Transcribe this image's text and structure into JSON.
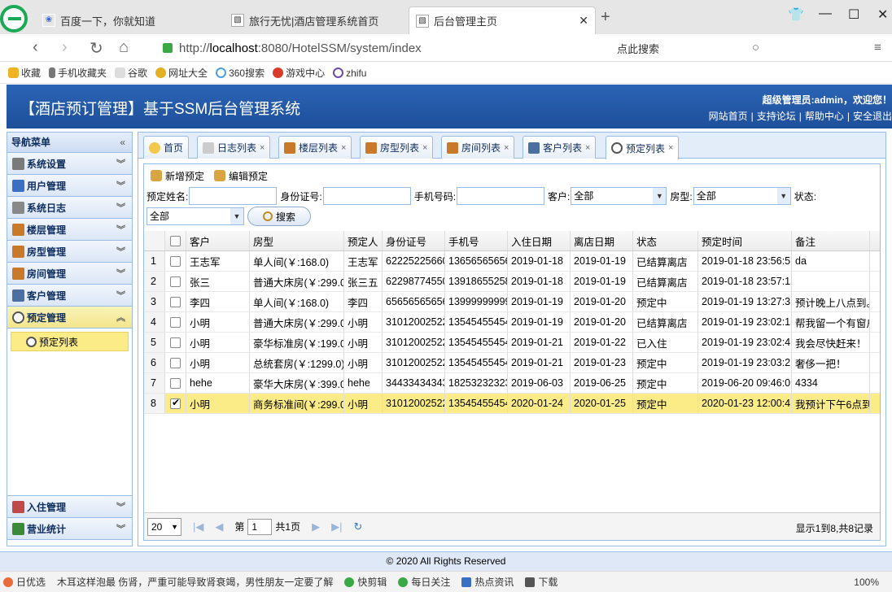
{
  "browser": {
    "tabs": [
      {
        "title": "百度一下，你就知道",
        "active": false
      },
      {
        "title": "旅行无忧|酒店管理系统首页",
        "active": false
      },
      {
        "title": "后台管理主页",
        "active": true
      }
    ],
    "url_prefix": "http://",
    "url_host": "localhost",
    "url_rest": ":8080/HotelSSM/system/index",
    "search_hint": "点此搜索",
    "bookmarks": [
      "收藏",
      "手机收藏夹",
      "谷歌",
      "网址大全",
      "360搜索",
      "游戏中心",
      "zhifu"
    ],
    "zoom": "100%"
  },
  "app": {
    "title": "【酒店预订管理】基于SSM后台管理系统",
    "welcome": "超级管理员:admin，欢迎您！",
    "links": [
      "网站首页",
      "支持论坛",
      "帮助中心",
      "安全退出"
    ]
  },
  "sidebar": {
    "header": "导航菜单",
    "items": [
      {
        "label": "系统设置",
        "color": "#7a7a7a"
      },
      {
        "label": "用户管理",
        "color": "#3a6fc1"
      },
      {
        "label": "系统日志",
        "color": "#888888"
      },
      {
        "label": "楼层管理",
        "color": "#c8792a"
      },
      {
        "label": "房型管理",
        "color": "#c8792a"
      },
      {
        "label": "房间管理",
        "color": "#c8792a"
      },
      {
        "label": "客户管理",
        "color": "#4a6fa0"
      },
      {
        "label": "预定管理",
        "color": "#6b6b6b"
      }
    ],
    "sub_item": "预定列表",
    "bottom_items": [
      {
        "label": "入住管理",
        "color": "#c04a4a"
      },
      {
        "label": "营业统计",
        "color": "#3a8a3a"
      }
    ]
  },
  "content_tabs": [
    {
      "label": "首页",
      "closable": false
    },
    {
      "label": "日志列表",
      "closable": true
    },
    {
      "label": "楼层列表",
      "closable": true
    },
    {
      "label": "房型列表",
      "closable": true
    },
    {
      "label": "房间列表",
      "closable": true
    },
    {
      "label": "客户列表",
      "closable": true
    },
    {
      "label": "预定列表",
      "closable": true,
      "active": true
    }
  ],
  "toolbar": {
    "add": "新增预定",
    "edit": "编辑预定"
  },
  "filters": {
    "name_label": "预定姓名:",
    "idcard_label": "身份证号:",
    "phone_label": "手机号码:",
    "customer_label": "客户:",
    "customer_value": "全部",
    "roomtype_label": "房型:",
    "roomtype_value": "全部",
    "status_label": "状态:",
    "status_value": "全部",
    "search_label": "搜索"
  },
  "grid": {
    "columns": [
      "客户",
      "房型",
      "预定人",
      "身份证号",
      "手机号",
      "入住日期",
      "离店日期",
      "状态",
      "预定时间",
      "备注"
    ],
    "rows": [
      {
        "n": "1",
        "checked": false,
        "cells": [
          "王志军",
          "单人间(￥:168.0)",
          "王志军",
          "62225225660",
          "13656565656",
          "2019-01-18",
          "2019-01-19",
          "已结算离店",
          "2019-01-18 23:56:5",
          "da"
        ]
      },
      {
        "n": "2",
        "checked": false,
        "cells": [
          "张三",
          "普通大床房(￥:299.0)",
          "张三五",
          "62298774550",
          "13918655258",
          "2019-01-18",
          "2019-01-19",
          "已结算离店",
          "2019-01-18 23:57:1",
          ""
        ]
      },
      {
        "n": "3",
        "checked": false,
        "cells": [
          "李四",
          "单人间(￥:168.0)",
          "李四",
          "65656565656",
          "13999999999",
          "2019-01-19",
          "2019-01-20",
          "预定中",
          "2019-01-19 13:27:3",
          "预计晚上八点到。"
        ]
      },
      {
        "n": "4",
        "checked": false,
        "cells": [
          "小明",
          "普通大床房(￥:299.0)",
          "小明",
          "31012002522",
          "13545455454",
          "2019-01-19",
          "2019-01-20",
          "已结算离店",
          "2019-01-19 23:02:1",
          "帮我留一个有窗户"
        ]
      },
      {
        "n": "5",
        "checked": false,
        "cells": [
          "小明",
          "豪华标准房(￥:199.0)",
          "小明",
          "31012002522",
          "13545455454",
          "2019-01-21",
          "2019-01-22",
          "已入住",
          "2019-01-19 23:02:4",
          "我会尽快赶来！"
        ]
      },
      {
        "n": "6",
        "checked": false,
        "cells": [
          "小明",
          "总统套房(￥:1299.0)",
          "小明",
          "31012002522",
          "13545455454",
          "2019-01-21",
          "2019-01-23",
          "预定中",
          "2019-01-19 23:03:2",
          "奢侈一把！"
        ]
      },
      {
        "n": "7",
        "checked": false,
        "cells": [
          "hehe",
          "豪华大床房(￥:399.0)",
          "hehe",
          "34433434343",
          "18253232323",
          "2019-06-03",
          "2019-06-25",
          "预定中",
          "2019-06-20 09:46:0",
          "4334"
        ]
      },
      {
        "n": "8",
        "checked": true,
        "cells": [
          "小明",
          "商务标准间(￥:299.0)",
          "小明",
          "31012002522",
          "13545455454",
          "2020-01-24",
          "2020-01-25",
          "预定中",
          "2020-01-23 12:00:4",
          "我预计下午6点到"
        ]
      }
    ]
  },
  "pager": {
    "page_size": "20",
    "page_label": "第",
    "page_value": "1",
    "total_pages": "共1页",
    "info": "显示1到8,共8记录"
  },
  "footer": "© 2020 All Rights Reserved",
  "statusbar": [
    "日优选",
    "木耳这样泡最 伤肾，严重可能导致肾衰竭，男性朋友一定要了解",
    "快剪辑",
    "每日关注",
    "热点资讯",
    "下载",
    "100%"
  ]
}
